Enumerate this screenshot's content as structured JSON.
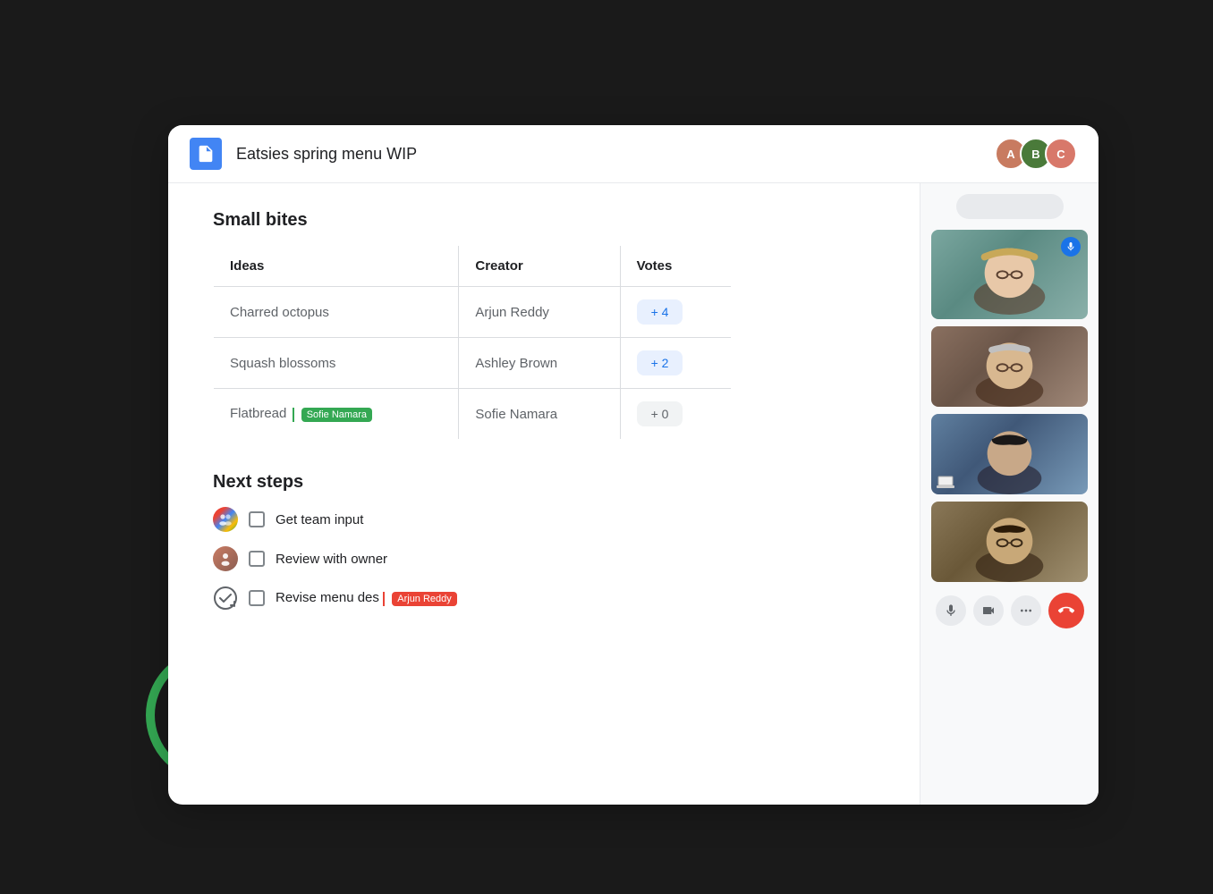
{
  "header": {
    "title": "Eatsies spring menu WIP",
    "doc_icon_label": "Google Docs icon",
    "avatars": [
      {
        "label": "User 1",
        "initials": "A"
      },
      {
        "label": "User 2",
        "initials": "B"
      },
      {
        "label": "User 3",
        "initials": "C"
      }
    ]
  },
  "document": {
    "section1_title": "Small bites",
    "table": {
      "headers": [
        "Ideas",
        "Creator",
        "Votes"
      ],
      "rows": [
        {
          "idea": "Charred octopus",
          "creator": "Arjun Reddy",
          "votes": "+ 4",
          "vote_style": "blue"
        },
        {
          "idea": "Squash blossoms",
          "creator": "Ashley Brown",
          "votes": "+ 2",
          "vote_style": "blue"
        },
        {
          "idea": "Flatbread",
          "creator": "Sofie Namara",
          "votes": "+ 0",
          "vote_style": "gray",
          "cursor": true,
          "cursor_label": "Sofie Namara"
        }
      ]
    },
    "section2_title": "Next steps",
    "tasks": [
      {
        "label": "Get team input",
        "avatar_type": "multi",
        "checked": false
      },
      {
        "label": "Review with owner",
        "avatar_type": "single",
        "checked": false
      },
      {
        "label": "Revise menu des",
        "avatar_type": "check-icon",
        "checked": false,
        "cursor": true,
        "cursor_label": "Arjun Reddy"
      }
    ]
  },
  "video_panel": {
    "tiles": [
      {
        "label": "Video participant 1 - woman with glasses"
      },
      {
        "label": "Video participant 2 - older man"
      },
      {
        "label": "Video participant 3 - young man"
      },
      {
        "label": "Video participant 4 - young man with glasses"
      }
    ],
    "controls": {
      "mic_label": "Microphone",
      "camera_label": "Camera",
      "more_label": "More options",
      "end_label": "End call"
    }
  }
}
